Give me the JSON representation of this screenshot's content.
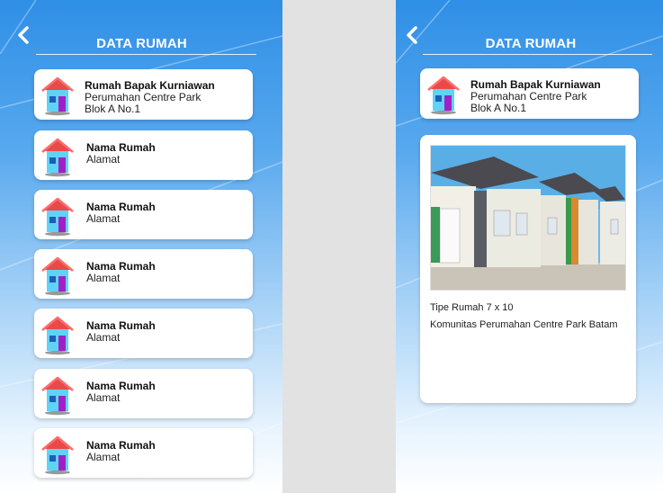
{
  "list_screen": {
    "title": "DATA RUMAH",
    "items": [
      {
        "name": "Rumah Bapak Kurniawan",
        "address1": "Perumahan Centre Park",
        "address2": "Blok A No.1"
      },
      {
        "name": "Nama Rumah",
        "address1": "Alamat",
        "address2": ""
      },
      {
        "name": "Nama Rumah",
        "address1": "Alamat",
        "address2": ""
      },
      {
        "name": "Nama Rumah",
        "address1": "Alamat",
        "address2": ""
      },
      {
        "name": "Nama Rumah",
        "address1": "Alamat",
        "address2": ""
      },
      {
        "name": "Nama Rumah",
        "address1": "Alamat",
        "address2": ""
      },
      {
        "name": "Nama Rumah",
        "address1": "Alamat",
        "address2": ""
      }
    ]
  },
  "detail_screen": {
    "title": "DATA RUMAH",
    "header": {
      "name": "Rumah Bapak Kurniawan",
      "address1": "Perumahan Centre Park",
      "address2": "Blok A No.1"
    },
    "type_text": "Tipe Rumah 7 x 10",
    "community_text": "Komunitas Perumahan Centre Park Batam"
  },
  "icons": {
    "back": "chevron-left-icon",
    "house": "house-icon"
  },
  "colors": {
    "header_blue": "#2f8fe6",
    "roof": "#e84a4a",
    "wall": "#5fd3f5",
    "door": "#a020c8"
  }
}
